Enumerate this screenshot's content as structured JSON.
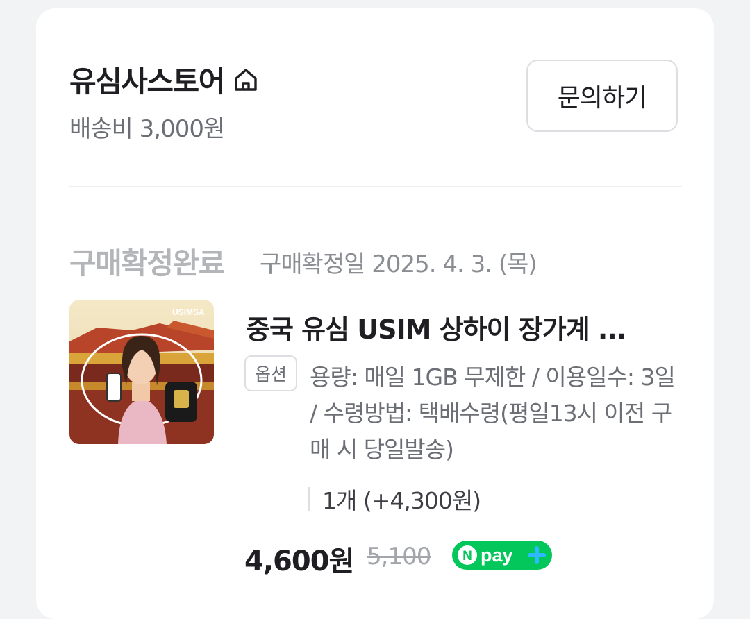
{
  "store": {
    "name": "유심사스토어",
    "shipping": "배송비 3,000원",
    "inquiry_label": "문의하기"
  },
  "order": {
    "status": "구매확정완료",
    "confirmed_date": "구매확정일 2025. 4. 3. (목)"
  },
  "product": {
    "title": "중국 유심 USIM 상하이 장가계 ...",
    "thumbnail_brand": "USIMSA",
    "option_badge": "옵션",
    "option_text": "용량: 매일 1GB 무제한 / 이용일수: 3일 / 수령방법: 택배수령(평일13시 이전 구매 시 당일발송)",
    "quantity": "1개 (+4,300원)",
    "price": "4,600원",
    "original_price": "5,100",
    "pay_badge": "pay"
  },
  "colors": {
    "npay_green": "#03c75a",
    "npay_blue": "#2db9ff"
  }
}
